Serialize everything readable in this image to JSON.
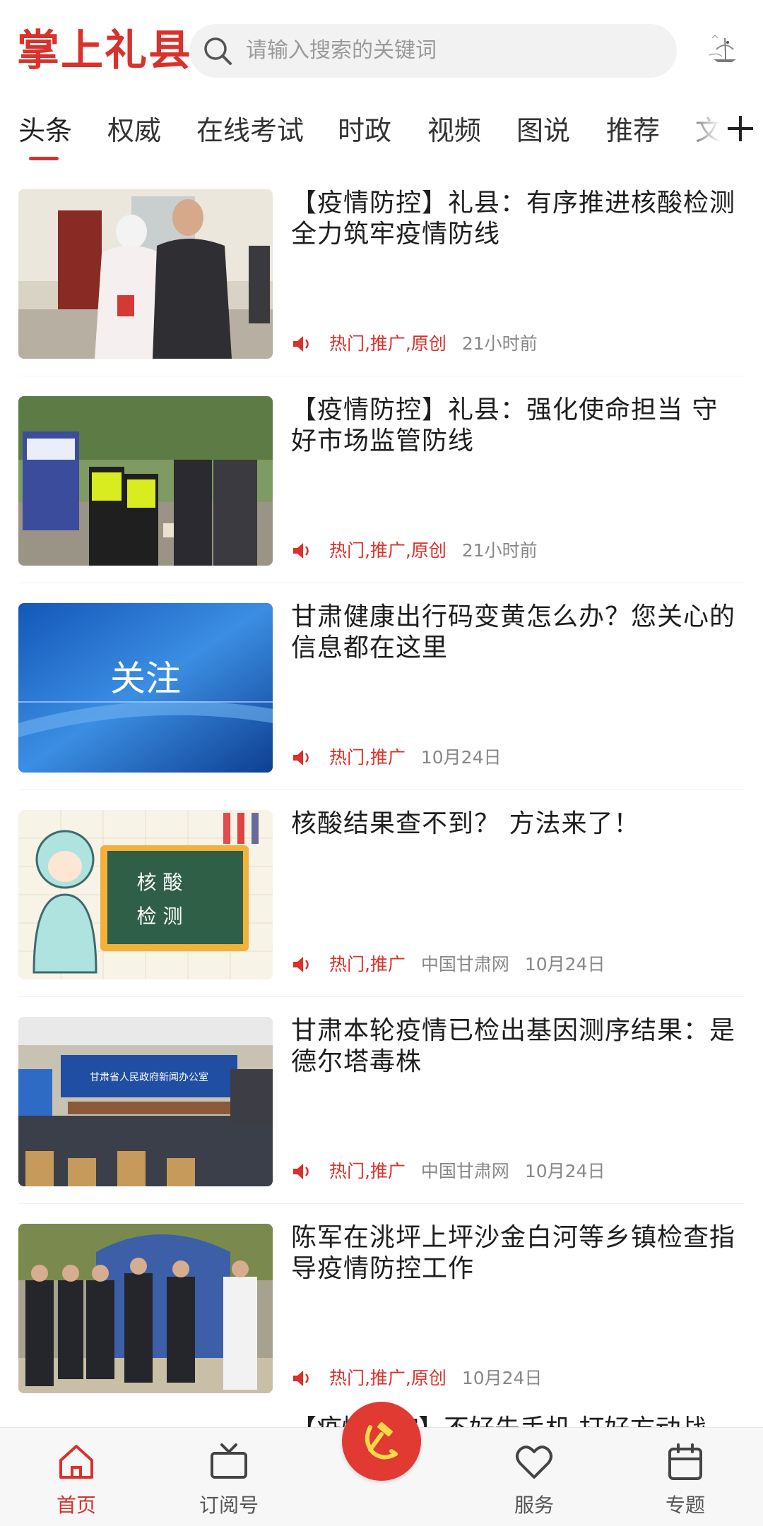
{
  "header": {
    "app_title": "掌上礼县",
    "search_placeholder": "请输入搜索的关键词",
    "logo_icon": "crane-logo-icon"
  },
  "tabs": [
    {
      "label": "头条",
      "active": true
    },
    {
      "label": "权威"
    },
    {
      "label": "在线考试"
    },
    {
      "label": "时政"
    },
    {
      "label": "视频"
    },
    {
      "label": "图说"
    },
    {
      "label": "推荐"
    },
    {
      "label": "文"
    }
  ],
  "add_tab_icon": "plus-icon",
  "news": [
    {
      "title": "【疫情防控】礼县：有序推进核酸检测 全力筑牢疫情防线",
      "tags": "热门,推广,原创",
      "source": "",
      "time": "21小时前"
    },
    {
      "title": "【疫情防控】礼县：强化使命担当 守好市场监管防线",
      "tags": "热门,推广,原创",
      "source": "",
      "time": "21小时前"
    },
    {
      "title": "甘肃健康出行码变黄怎么办？您关心的信息都在这里",
      "tags": "热门,推广",
      "source": "",
      "time": "10月24日",
      "thumb_text": "关注"
    },
    {
      "title": "核酸结果查不到？ 方法来了！",
      "tags": "热门,推广",
      "source": "中国甘肃网",
      "time": "10月24日",
      "thumb_text_1": "核 酸",
      "thumb_text_2": "检 测"
    },
    {
      "title": "甘肃本轮疫情已检出基因测序结果：是德尔塔毒株",
      "tags": "热门,推广",
      "source": "中国甘肃网",
      "time": "10月24日",
      "thumb_text": "甘肃省人民政府新闻办公室"
    },
    {
      "title": "陈军在洮坪上坪沙金白河等乡镇检查指导疫情防控工作",
      "tags": "热门,推广,原创",
      "source": "",
      "time": "10月24日"
    }
  ],
  "peek_title": "【疫情防控】不好先手机 打好方动战",
  "bottom_nav": {
    "home": "首页",
    "subscribe": "订阅号",
    "service": "服务",
    "topics": "专题"
  },
  "colors": {
    "brand": "#d9312b",
    "text": "#1e1e1e",
    "muted": "#888888"
  }
}
